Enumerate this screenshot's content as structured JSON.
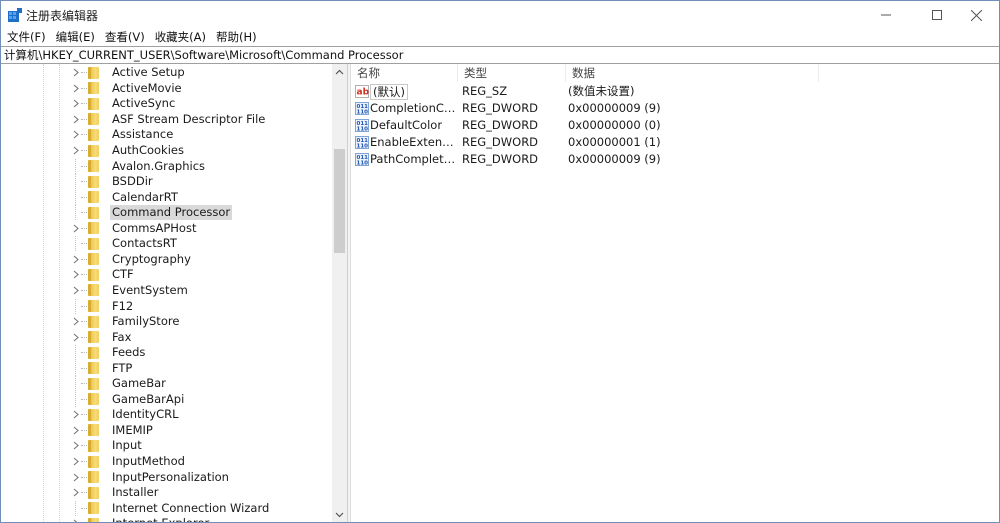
{
  "window": {
    "title": "注册表编辑器",
    "controls": {
      "minimize": "─",
      "maximize": "☐",
      "close": "✕"
    }
  },
  "menu": [
    "文件(F)",
    "编辑(E)",
    "查看(V)",
    "收藏夹(A)",
    "帮助(H)"
  ],
  "address": "计算机\\HKEY_CURRENT_USER\\Software\\Microsoft\\Command Processor",
  "tree": {
    "selected": "Command Processor",
    "items": [
      {
        "label": "Active Setup",
        "expandable": true
      },
      {
        "label": "ActiveMovie",
        "expandable": true
      },
      {
        "label": "ActiveSync",
        "expandable": true
      },
      {
        "label": "ASF Stream Descriptor File",
        "expandable": true
      },
      {
        "label": "Assistance",
        "expandable": true
      },
      {
        "label": "AuthCookies",
        "expandable": true
      },
      {
        "label": "Avalon.Graphics",
        "expandable": false
      },
      {
        "label": "BSDDir",
        "expandable": false
      },
      {
        "label": "CalendarRT",
        "expandable": false
      },
      {
        "label": "Command Processor",
        "expandable": false
      },
      {
        "label": "CommsAPHost",
        "expandable": true
      },
      {
        "label": "ContactsRT",
        "expandable": false
      },
      {
        "label": "Cryptography",
        "expandable": true
      },
      {
        "label": "CTF",
        "expandable": true
      },
      {
        "label": "EventSystem",
        "expandable": true
      },
      {
        "label": "F12",
        "expandable": false
      },
      {
        "label": "FamilyStore",
        "expandable": true
      },
      {
        "label": "Fax",
        "expandable": true
      },
      {
        "label": "Feeds",
        "expandable": false
      },
      {
        "label": "FTP",
        "expandable": false
      },
      {
        "label": "GameBar",
        "expandable": false
      },
      {
        "label": "GameBarApi",
        "expandable": false
      },
      {
        "label": "IdentityCRL",
        "expandable": true
      },
      {
        "label": "IMEMIP",
        "expandable": true
      },
      {
        "label": "Input",
        "expandable": true
      },
      {
        "label": "InputMethod",
        "expandable": true
      },
      {
        "label": "InputPersonalization",
        "expandable": true
      },
      {
        "label": "Installer",
        "expandable": true
      },
      {
        "label": "Internet Connection Wizard",
        "expandable": false
      },
      {
        "label": "Internet Explorer",
        "expandable": true
      }
    ]
  },
  "values": {
    "columns": [
      "名称",
      "类型",
      "数据"
    ],
    "rows": [
      {
        "name": "(默认)",
        "type": "REG_SZ",
        "data": "(数值未设置)",
        "icon": "string-value-icon"
      },
      {
        "name": "CompletionChar",
        "type": "REG_DWORD",
        "data": "0x00000009 (9)",
        "icon": "binary-value-icon"
      },
      {
        "name": "DefaultColor",
        "type": "REG_DWORD",
        "data": "0x00000000 (0)",
        "icon": "binary-value-icon"
      },
      {
        "name": "EnableExtensio...",
        "type": "REG_DWORD",
        "data": "0x00000001 (1)",
        "icon": "binary-value-icon"
      },
      {
        "name": "PathCompletio...",
        "type": "REG_DWORD",
        "data": "0x00000009 (9)",
        "icon": "binary-value-icon"
      }
    ]
  },
  "scrollbar": {
    "up_arrow": "⌃",
    "down_arrow": "⌄",
    "position_fraction": 0.19
  }
}
